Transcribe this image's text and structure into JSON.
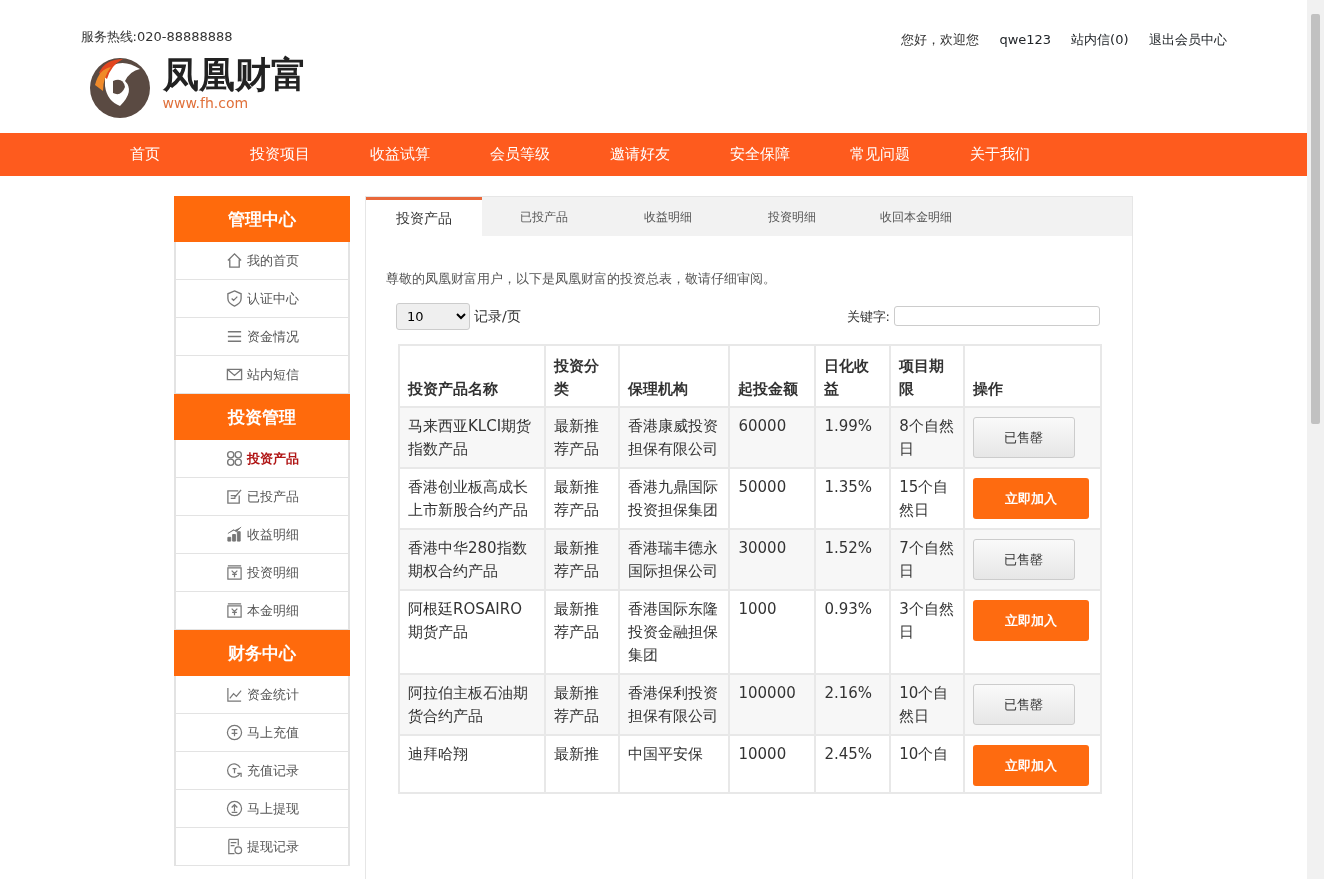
{
  "header": {
    "hotline": "服务热线:020-88888888",
    "greeting": "您好，欢迎您",
    "username": "qwe123",
    "messages": "站内信(0)",
    "logout": "退出会员中心",
    "logo": {
      "name": "凤凰财富",
      "url": "www.fh.com"
    }
  },
  "nav": [
    "首页",
    "投资项目",
    "收益试算",
    "会员等级",
    "邀请好友",
    "安全保障",
    "常见问题",
    "关于我们"
  ],
  "sidebar": [
    {
      "title": "管理中心",
      "items": [
        {
          "label": "我的首页",
          "selected": false
        },
        {
          "label": "认证中心",
          "selected": false
        },
        {
          "label": "资金情况",
          "selected": false
        },
        {
          "label": "站内短信",
          "selected": false
        }
      ]
    },
    {
      "title": "投资管理",
      "items": [
        {
          "label": "投资产品",
          "selected": true
        },
        {
          "label": "已投产品",
          "selected": false
        },
        {
          "label": "收益明细",
          "selected": false
        },
        {
          "label": "投资明细",
          "selected": false
        },
        {
          "label": "本金明细",
          "selected": false
        }
      ]
    },
    {
      "title": "财务中心",
      "items": [
        {
          "label": "资金统计",
          "selected": false
        },
        {
          "label": "马上充值",
          "selected": false
        },
        {
          "label": "充值记录",
          "selected": false
        },
        {
          "label": "马上提现",
          "selected": false
        },
        {
          "label": "提现记录",
          "selected": false
        }
      ]
    }
  ],
  "tabs": [
    {
      "label": "投资产品",
      "selected": true
    },
    {
      "label": "已投产品",
      "selected": false
    },
    {
      "label": "收益明细",
      "selected": false
    },
    {
      "label": "投资明细",
      "selected": false
    },
    {
      "label": "收回本金明细",
      "selected": false
    }
  ],
  "intro": "尊敬的凤凰财富用户，以下是凤凰财富的投资总表，敬请仔细审阅。",
  "page_size": {
    "value": "10",
    "label": "记录/页"
  },
  "keyword": {
    "label": "关键字:"
  },
  "table": {
    "columns": [
      "投资产品名称",
      "投资分类",
      "保理机构",
      "起投金额",
      "日化收益",
      "项目期限",
      "操作"
    ],
    "rows": [
      {
        "cells": [
          "马来西亚KLCI期货指数产品",
          "最新推荐产品",
          "香港康威投资担保有限公司",
          "60000",
          "1.99%",
          "8个自然日"
        ],
        "action": {
          "label": "已售罄",
          "kind": "sold_out"
        }
      },
      {
        "cells": [
          "香港创业板高成长上市新股合约产品",
          "最新推荐产品",
          "香港九鼎国际投资担保集团",
          "50000",
          "1.35%",
          "15个自然日"
        ],
        "action": {
          "label": "立即加入",
          "kind": "join"
        }
      },
      {
        "cells": [
          "香港中华280指数期权合约产品",
          "最新推荐产品",
          "香港瑞丰德永国际担保公司",
          "30000",
          "1.52%",
          "7个自然日"
        ],
        "action": {
          "label": "已售罄",
          "kind": "sold_out"
        }
      },
      {
        "cells": [
          "阿根廷ROSAIRO期货产品",
          "最新推荐产品",
          "香港国际东隆投资金融担保集团",
          "1000",
          "0.93%",
          "3个自然日"
        ],
        "action": {
          "label": "立即加入",
          "kind": "join"
        }
      },
      {
        "cells": [
          "阿拉伯主板石油期货合约产品",
          "最新推荐产品",
          "香港保利投资担保有限公司",
          "100000",
          "2.16%",
          "10个自然日"
        ],
        "action": {
          "label": "已售罄",
          "kind": "sold_out"
        }
      },
      {
        "cells": [
          "迪拜哈翔",
          "最新推",
          "中国平安保",
          "10000",
          "2.45%",
          "10个自"
        ],
        "action": {
          "label": "立即加入",
          "kind": "join"
        }
      }
    ]
  }
}
